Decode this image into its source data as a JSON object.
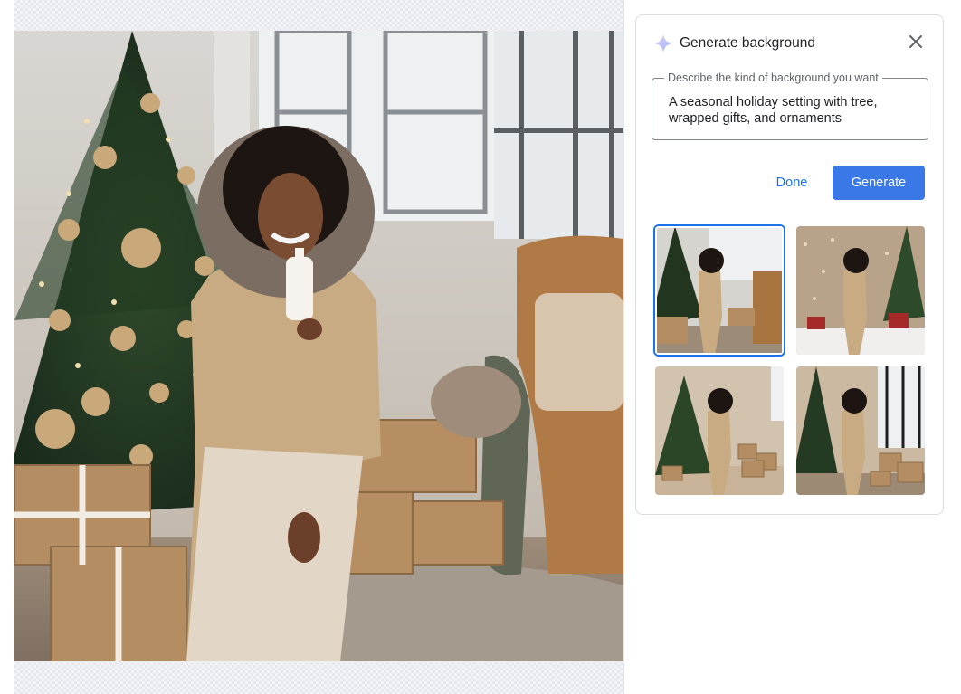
{
  "panel": {
    "title": "Generate background",
    "prompt_label": "Describe the kind of background you want",
    "prompt_value": "A seasonal holiday setting with tree, wrapped gifts, and ornaments",
    "done_label": "Done",
    "generate_label": "Generate"
  },
  "icons": {
    "sparkle": "sparkle-icon",
    "close": "close-icon"
  },
  "colors": {
    "accent": "#1a73e8",
    "button": "#3b78e7",
    "text": "#202124",
    "muted": "#5f6368",
    "border": "#dadce0"
  },
  "thumbnails": [
    {
      "id": "option-1",
      "selected": true
    },
    {
      "id": "option-2",
      "selected": false
    },
    {
      "id": "option-3",
      "selected": false
    },
    {
      "id": "option-4",
      "selected": false
    }
  ]
}
